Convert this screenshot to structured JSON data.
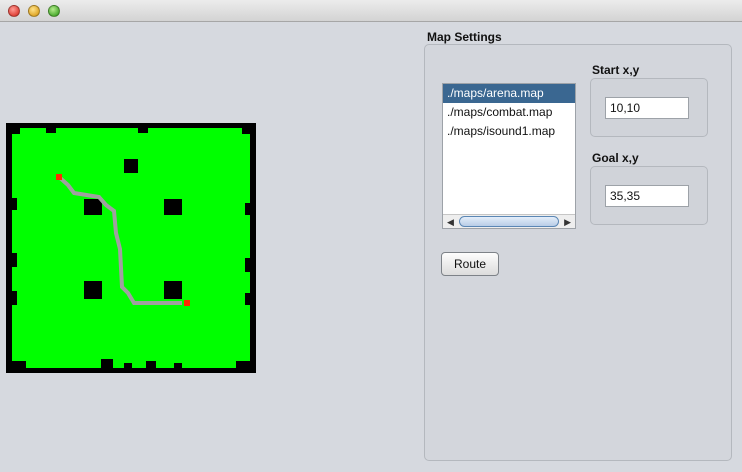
{
  "window": {
    "title": ""
  },
  "settings": {
    "title": "Map Settings",
    "maps": [
      "./maps/arena.map",
      "./maps/combat.map",
      "./maps/isound1.map"
    ],
    "selected_map_index": 0,
    "start_label": "Start x,y",
    "start_value": "10,10",
    "goal_label": "Goal x,y",
    "goal_value": "35,35",
    "route_label": "Route"
  },
  "map": {
    "walkable_color": "#00ff00",
    "wall_color": "#000000",
    "path_color": "#a0a0a0",
    "endpoint_color": "#ff2a00"
  }
}
